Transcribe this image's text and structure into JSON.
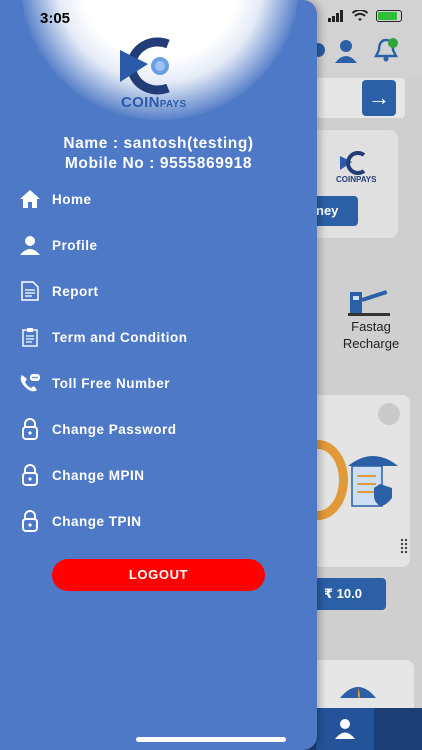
{
  "status_bar": {
    "time": "3:05"
  },
  "brand": {
    "logo_main": "COIN",
    "logo_sub": "PAYS"
  },
  "user": {
    "name_line": "Name : santosh(testing)",
    "mobile_line": "Mobile No : 9555869918"
  },
  "menu": {
    "items": [
      {
        "label": "Home",
        "icon": "home-icon"
      },
      {
        "label": "Profile",
        "icon": "user-icon"
      },
      {
        "label": "Report",
        "icon": "document-icon"
      },
      {
        "label": "Term and Condition",
        "icon": "clipboard-icon"
      },
      {
        "label": "Toll Free Number",
        "icon": "phone-call-icon"
      },
      {
        "label": "Change Password",
        "icon": "lock-icon"
      },
      {
        "label": "Change MPIN",
        "icon": "lock-icon"
      },
      {
        "label": "Change TPIN",
        "icon": "lock-icon"
      }
    ]
  },
  "logout_label": "LOGOUT",
  "background": {
    "card_logo_text": "COINPAYS",
    "money_button_partial": "ney",
    "fastag_label": "Fastag Recharge",
    "amount_partial": "₹ 10.0",
    "accent_color": "#2b5fa6",
    "drawer_color": "#4e79c6",
    "logout_color": "#ff0000"
  }
}
